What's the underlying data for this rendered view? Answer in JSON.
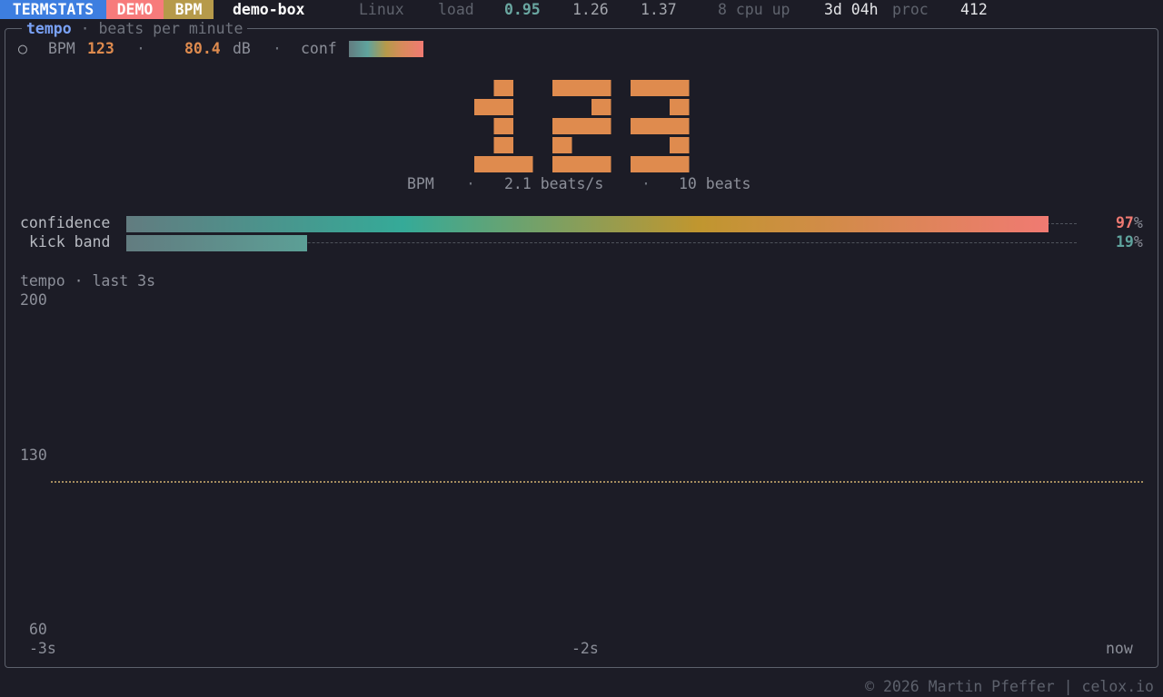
{
  "header": {
    "app_badge": "TERMSTATS",
    "demo_badge": "DEMO",
    "mode_badge": "BPM",
    "hostname": "demo-box",
    "os": "Linux",
    "load_label": "load",
    "load_1": "0.95",
    "load_5": "1.26",
    "load_15": "1.37",
    "cpu": "8 cpu up",
    "uptime": "3d 04h",
    "proc_label": "proc",
    "proc_count": "412"
  },
  "panel": {
    "title": "tempo",
    "subtitle": "· beats per minute"
  },
  "status_line": {
    "indicator": "○",
    "bpm_label": "BPM",
    "bpm_value": "123",
    "sep": "·",
    "db_value": "80.4",
    "db_unit": "dB",
    "conf_label": "conf"
  },
  "big_readout": {
    "value": "123",
    "unit": "BPM",
    "sep": "·",
    "beats_per_sec": "2.1 beats/s",
    "beats": "10 beats"
  },
  "meters": [
    {
      "label": "confidence",
      "value": 97,
      "value_text": "97",
      "unit": "%"
    },
    {
      "label": "kick band",
      "value": 19,
      "value_text": "19",
      "unit": "%"
    }
  ],
  "sparkline": {
    "title": "tempo · last 3s",
    "y_max": "200",
    "y_mid": "130",
    "y_min": "60",
    "x_start": "-3s",
    "x_mid": "-2s",
    "x_end": "now",
    "current_value": 123,
    "y_range": [
      60,
      200
    ]
  },
  "footer": {
    "text": "© 2026 Martin Pfeffer | celox.io"
  },
  "colors": {
    "app_badge_bg": "#3d7ee0",
    "demo_badge_bg": "#f77b7b",
    "mode_badge_bg": "#b69a4a",
    "accent_orange": "#df8b4e",
    "teal": "#5fa39d",
    "pink": "#f07a72"
  }
}
